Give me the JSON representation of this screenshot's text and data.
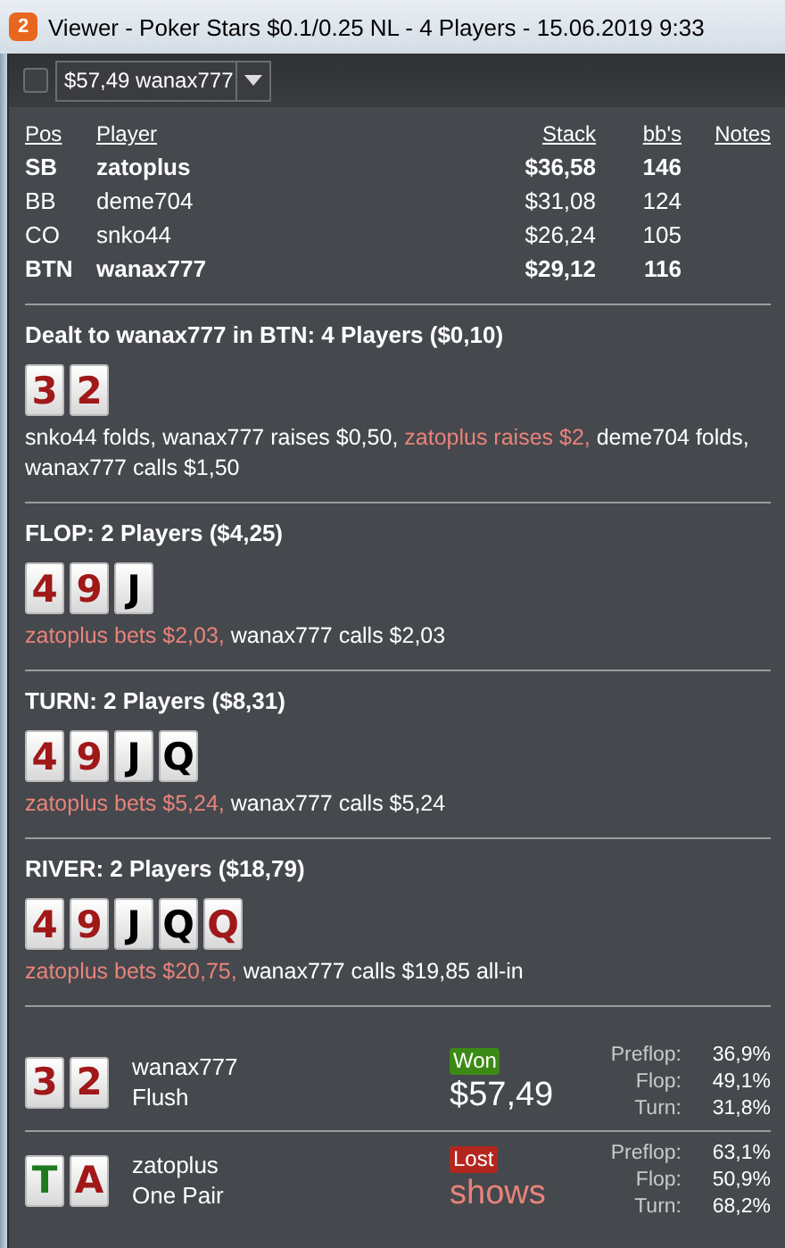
{
  "window": {
    "badge": "2",
    "title": "Viewer - Poker Stars $0.1/0.25 NL - 4 Players - 15.06.2019 9:33"
  },
  "toolbar": {
    "checkbox": {
      "checked": false
    },
    "hand_select": {
      "value": "$57,49 wanax777"
    }
  },
  "players": {
    "columns": [
      "Pos",
      "Player",
      "Stack",
      "bb's",
      "Notes"
    ],
    "rows": [
      {
        "pos": "SB",
        "player": "zatoplus",
        "stack": "$36,58",
        "bbs": "146",
        "highlighted": true
      },
      {
        "pos": "BB",
        "player": "deme704",
        "stack": "$31,08",
        "bbs": "124",
        "highlighted": false
      },
      {
        "pos": "CO",
        "player": "snko44",
        "stack": "$26,24",
        "bbs": "105",
        "highlighted": false
      },
      {
        "pos": "BTN",
        "player": "wanax777",
        "stack": "$29,12",
        "bbs": "116",
        "highlighted": true
      }
    ]
  },
  "streets": [
    {
      "title": "Dealt to wanax777 in BTN: 4 Players ($0,10)",
      "cards": [
        {
          "rank": "3",
          "color": "#a01818"
        },
        {
          "rank": "2",
          "color": "#a01818"
        }
      ],
      "actions": [
        {
          "text": "snko44 folds, wanax777 raises $0,50, ",
          "color": "#ffffff"
        },
        {
          "text": "zatoplus raises $2,",
          "color": "#e8837a"
        },
        {
          "text": " deme704 folds, wanax777 calls $1,50",
          "color": "#ffffff"
        }
      ]
    },
    {
      "title": "FLOP: 2 Players ($4,25)",
      "cards": [
        {
          "rank": "4",
          "color": "#a01818"
        },
        {
          "rank": "9",
          "color": "#a01818"
        },
        {
          "rank": "J",
          "color": "#000000"
        }
      ],
      "actions": [
        {
          "text": "zatoplus bets $2,03,",
          "color": "#e8837a"
        },
        {
          "text": " wanax777 calls $2,03",
          "color": "#ffffff"
        }
      ]
    },
    {
      "title": "TURN: 2 Players ($8,31)",
      "cards": [
        {
          "rank": "4",
          "color": "#a01818"
        },
        {
          "rank": "9",
          "color": "#a01818"
        },
        {
          "rank": "J",
          "color": "#000000"
        },
        {
          "rank": "Q",
          "color": "#000000"
        }
      ],
      "actions": [
        {
          "text": "zatoplus bets $5,24,",
          "color": "#e8837a"
        },
        {
          "text": " wanax777 calls $5,24",
          "color": "#ffffff"
        }
      ]
    },
    {
      "title": "RIVER: 2 Players ($18,79)",
      "cards": [
        {
          "rank": "4",
          "color": "#a01818"
        },
        {
          "rank": "9",
          "color": "#a01818"
        },
        {
          "rank": "J",
          "color": "#000000"
        },
        {
          "rank": "Q",
          "color": "#000000"
        },
        {
          "rank": "Q",
          "color": "#a01818"
        }
      ],
      "actions": [
        {
          "text": "zatoplus bets $20,75,",
          "color": "#e8837a"
        },
        {
          "text": " wanax777 calls $19,85 all-in",
          "color": "#ffffff"
        }
      ]
    }
  ],
  "results": [
    {
      "cards": [
        {
          "rank": "3",
          "color": "#a01818"
        },
        {
          "rank": "2",
          "color": "#a01818"
        }
      ],
      "player": "wanax777",
      "hand": "Flush",
      "kind": "won",
      "status": "Won",
      "amount": "$57,49",
      "equity": [
        {
          "label": "Preflop:",
          "value": "36,9%"
        },
        {
          "label": "Flop:",
          "value": "49,1%"
        },
        {
          "label": "Turn:",
          "value": "31,8%"
        }
      ]
    },
    {
      "cards": [
        {
          "rank": "T",
          "color": "#1f7a1f"
        },
        {
          "rank": "A",
          "color": "#a01818"
        }
      ],
      "player": "zatoplus",
      "hand": "One Pair",
      "kind": "lost",
      "status": "Lost",
      "amount": "shows",
      "equity": [
        {
          "label": "Preflop:",
          "value": "63,1%"
        },
        {
          "label": "Flop:",
          "value": "50,9%"
        },
        {
          "label": "Turn:",
          "value": "68,2%"
        }
      ]
    }
  ]
}
